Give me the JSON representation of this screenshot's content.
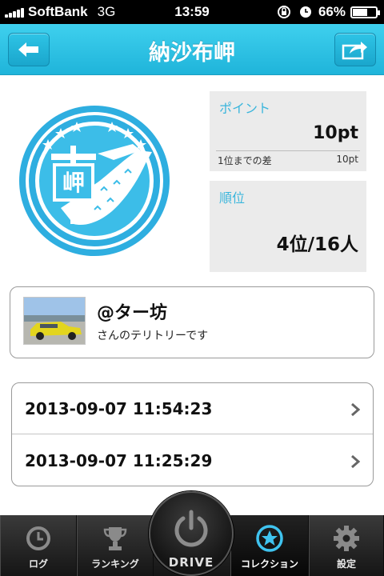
{
  "status_bar": {
    "carrier": "SoftBank",
    "network": "3G",
    "time": "13:59",
    "battery": "66%",
    "battery_level": 0.66
  },
  "nav": {
    "title": "納沙布岬",
    "back_icon": "arrow-left-icon",
    "share_icon": "share-arrow-icon"
  },
  "badge": {
    "kanji": "岬",
    "icon": "cape-territory-badge"
  },
  "points": {
    "label": "ポイント",
    "value": "10pt",
    "diff_label": "1位までの差",
    "diff_value": "10pt"
  },
  "rank": {
    "label": "順位",
    "value": "4位/16人"
  },
  "territory": {
    "owner_name": "@ター坊",
    "caption": "さんのテリトリーです"
  },
  "history": [
    {
      "timestamp": "2013-09-07 11:54:23"
    },
    {
      "timestamp": "2013-09-07 11:25:29"
    }
  ],
  "tabs": [
    {
      "label": "ログ",
      "icon": "clock-icon"
    },
    {
      "label": "ランキング",
      "icon": "trophy-icon"
    },
    {
      "label": "DRIVE",
      "icon": "power-icon"
    },
    {
      "label": "コレクション",
      "icon": "star-badge-icon",
      "active": true
    },
    {
      "label": "設定",
      "icon": "gear-icon"
    }
  ],
  "colors": {
    "accent": "#2ebde2",
    "label_blue": "#3bb6dc",
    "tab_bar": "#1e1e1e"
  }
}
